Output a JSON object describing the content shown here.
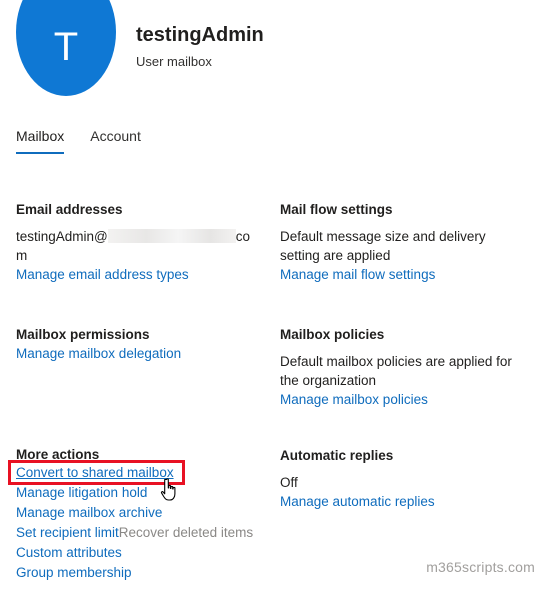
{
  "header": {
    "avatar_initial": "T",
    "title": "testingAdmin",
    "subtitle": "User mailbox"
  },
  "tabs": [
    {
      "label": "Mailbox",
      "active": true
    },
    {
      "label": "Account",
      "active": false
    }
  ],
  "email_addresses": {
    "heading": "Email addresses",
    "address_prefix": "testingAdmin@",
    "address_suffix_a": "co",
    "address_suffix_b": "m",
    "link": "Manage email address types"
  },
  "mail_flow": {
    "heading": "Mail flow settings",
    "text_line1": "Default message size and delivery",
    "text_line2": "setting are applied",
    "link": "Manage mail flow settings"
  },
  "mailbox_permissions": {
    "heading": "Mailbox permissions",
    "link": "Manage mailbox delegation"
  },
  "mailbox_policies": {
    "heading": "Mailbox policies",
    "text_line1": "Default mailbox policies are applied for",
    "text_line2": "the organization",
    "link": "Manage mailbox policies"
  },
  "more_actions": {
    "heading": "More actions",
    "convert": "Convert to shared mailbox",
    "litigation": "Manage litigation hold",
    "archive": "Manage mailbox archive",
    "recipient_limit": "Set recipient limit",
    "recover": "Recover deleted items",
    "custom_attributes": "Custom attributes",
    "group_membership": "Group membership"
  },
  "automatic_replies": {
    "heading": "Automatic replies",
    "status": "Off",
    "link": "Manage automatic replies"
  },
  "watermark": "m365scripts.com",
  "colors": {
    "accent": "#0f6cbd",
    "avatar": "#0f78d4",
    "highlight": "#e81123"
  }
}
